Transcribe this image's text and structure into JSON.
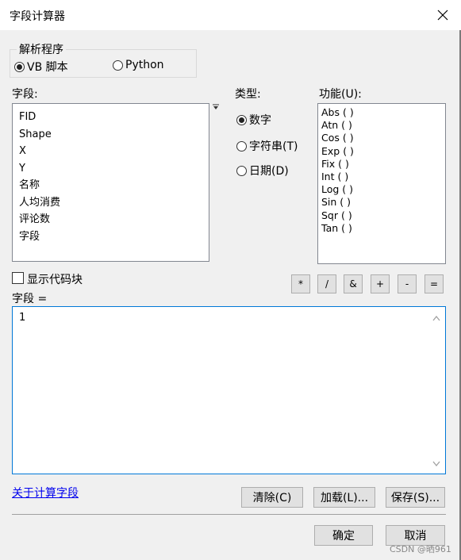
{
  "window": {
    "title": "字段计算器"
  },
  "parser": {
    "legend": "解析程序",
    "options": [
      {
        "label": "VB 脚本",
        "selected": true
      },
      {
        "label": "Python",
        "selected": false
      }
    ]
  },
  "fields": {
    "label": "字段:",
    "items": [
      "FID",
      "Shape",
      "X",
      "Y",
      "名称",
      "人均消费",
      "评论数",
      "字段"
    ]
  },
  "type": {
    "label": "类型:",
    "options": [
      {
        "label": "数字",
        "selected": true
      },
      {
        "label": "字符串(T)",
        "selected": false
      },
      {
        "label": "日期(D)",
        "selected": false
      }
    ]
  },
  "functions": {
    "label": "功能(U):",
    "items": [
      "Abs ( )",
      "Atn ( )",
      "Cos ( )",
      "Exp ( )",
      "Fix ( )",
      "Int ( )",
      "Log ( )",
      "Sin ( )",
      "Sqr ( )",
      "Tan ( )"
    ]
  },
  "show_codeblock": {
    "label": "显示代码块",
    "checked": false
  },
  "operators": [
    "*",
    "/",
    "&",
    "+",
    "-",
    "="
  ],
  "expression": {
    "label": "字段 =",
    "value": "1"
  },
  "about_link": "关于计算字段",
  "buttons": {
    "clear": "清除(C)",
    "load": "加载(L)...",
    "save": "保存(S)...",
    "ok": "确定",
    "cancel": "取消"
  },
  "watermark": "CSDN @晒961"
}
